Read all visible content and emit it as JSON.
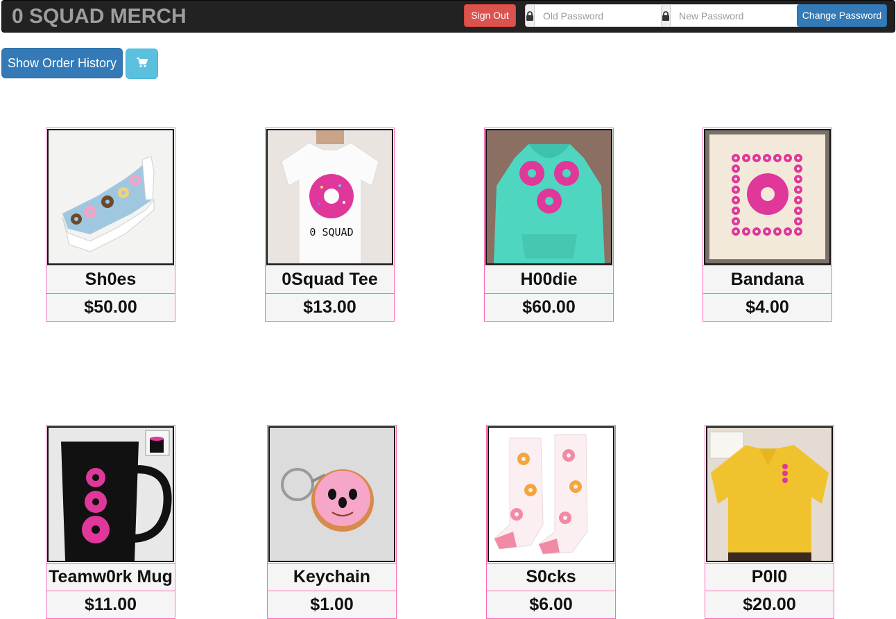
{
  "navbar": {
    "brand": "0 SQUAD MERCH",
    "sign_out_label": "Sign Out",
    "old_password_placeholder": "Old Password",
    "new_password_placeholder": "New Password",
    "change_password_label": "Change Password"
  },
  "actions": {
    "order_history_label": "Show Order History",
    "cart_icon": "shopping-cart-icon"
  },
  "colors": {
    "navbar_bg": "#222222",
    "danger": "#d9534f",
    "primary": "#337ab7",
    "info": "#5bc0de",
    "card_border": "#ff69b4"
  },
  "products": [
    {
      "name": "Sh0es",
      "price": "$50.00",
      "image_icon": "shoe-image"
    },
    {
      "name": "0Squad Tee",
      "price": "$13.00",
      "image_icon": "tshirt-image"
    },
    {
      "name": "H00die",
      "price": "$60.00",
      "image_icon": "hoodie-image"
    },
    {
      "name": "Bandana",
      "price": "$4.00",
      "image_icon": "bandana-image"
    },
    {
      "name": "Teamw0rk Mug",
      "price": "$11.00",
      "image_icon": "mug-image"
    },
    {
      "name": "Keychain",
      "price": "$1.00",
      "image_icon": "keychain-image"
    },
    {
      "name": "S0cks",
      "price": "$6.00",
      "image_icon": "socks-image"
    },
    {
      "name": "P0l0",
      "price": "$20.00",
      "image_icon": "polo-image"
    }
  ],
  "tee_print_text": "0 SQUAD"
}
